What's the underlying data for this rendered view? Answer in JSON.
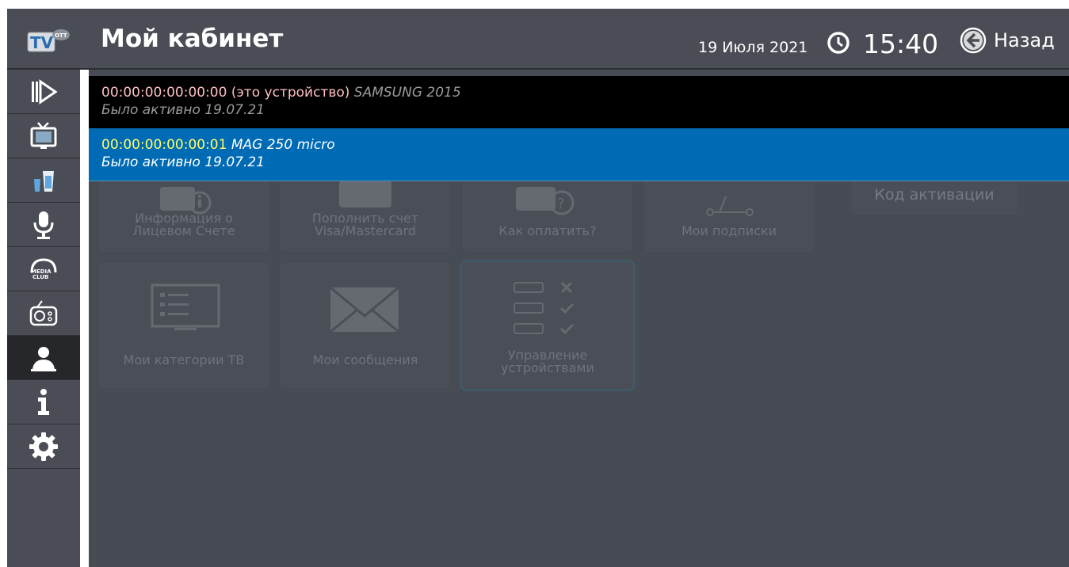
{
  "header": {
    "title": "Мой кабинет",
    "date": "19 Июля 2021",
    "time": "15:40",
    "back_label": "Назад",
    "logo_icon": "tv-ott-logo",
    "clock_icon": "clock-icon"
  },
  "sidebar": {
    "items": [
      {
        "icon": "play-icon"
      },
      {
        "icon": "tv-icon"
      },
      {
        "icon": "cinema-icon"
      },
      {
        "icon": "microphone-icon"
      },
      {
        "icon": "media-club-icon"
      },
      {
        "icon": "radio-icon"
      },
      {
        "icon": "user-icon",
        "active": true
      },
      {
        "icon": "info-icon"
      },
      {
        "icon": "gear-icon"
      }
    ]
  },
  "tiles": {
    "items": [
      {
        "label": "Информация о\nЛицевом Счете",
        "icon": "wallet-info-icon"
      },
      {
        "label": "Пополнить счет\nVisa/Mastercard",
        "icon": "card-icon"
      },
      {
        "label": "Как оплатить?",
        "icon": "wallet-question-icon"
      },
      {
        "label": "Мои подписки",
        "icon": "subscriptions-icon"
      },
      {
        "label": "Код активации",
        "icon": "activation-icon"
      },
      {
        "label": "Мои категории ТВ",
        "icon": "tv-list-icon"
      },
      {
        "label": "Мои сообщения",
        "icon": "envelope-icon"
      },
      {
        "label": "Управление\nустройствами",
        "icon": "device-manage-icon",
        "focused": true
      }
    ]
  },
  "devices": [
    {
      "mac": "00:00:00:00:00:00",
      "tag": "(это устройство)",
      "model": "SAMSUNG 2015",
      "activity": "Было активно 19.07.21"
    },
    {
      "mac": "00:00:00:00:00:01",
      "tag": "",
      "model": "MAG 250 micro",
      "activity": "Было активно 19.07.21",
      "selected": true
    }
  ],
  "colors": {
    "background": "#474b53",
    "selected_row": "#006bb5",
    "current_row": "#000000",
    "mac_current": "#ffbfc2",
    "mac_selected": "#ffff66"
  }
}
